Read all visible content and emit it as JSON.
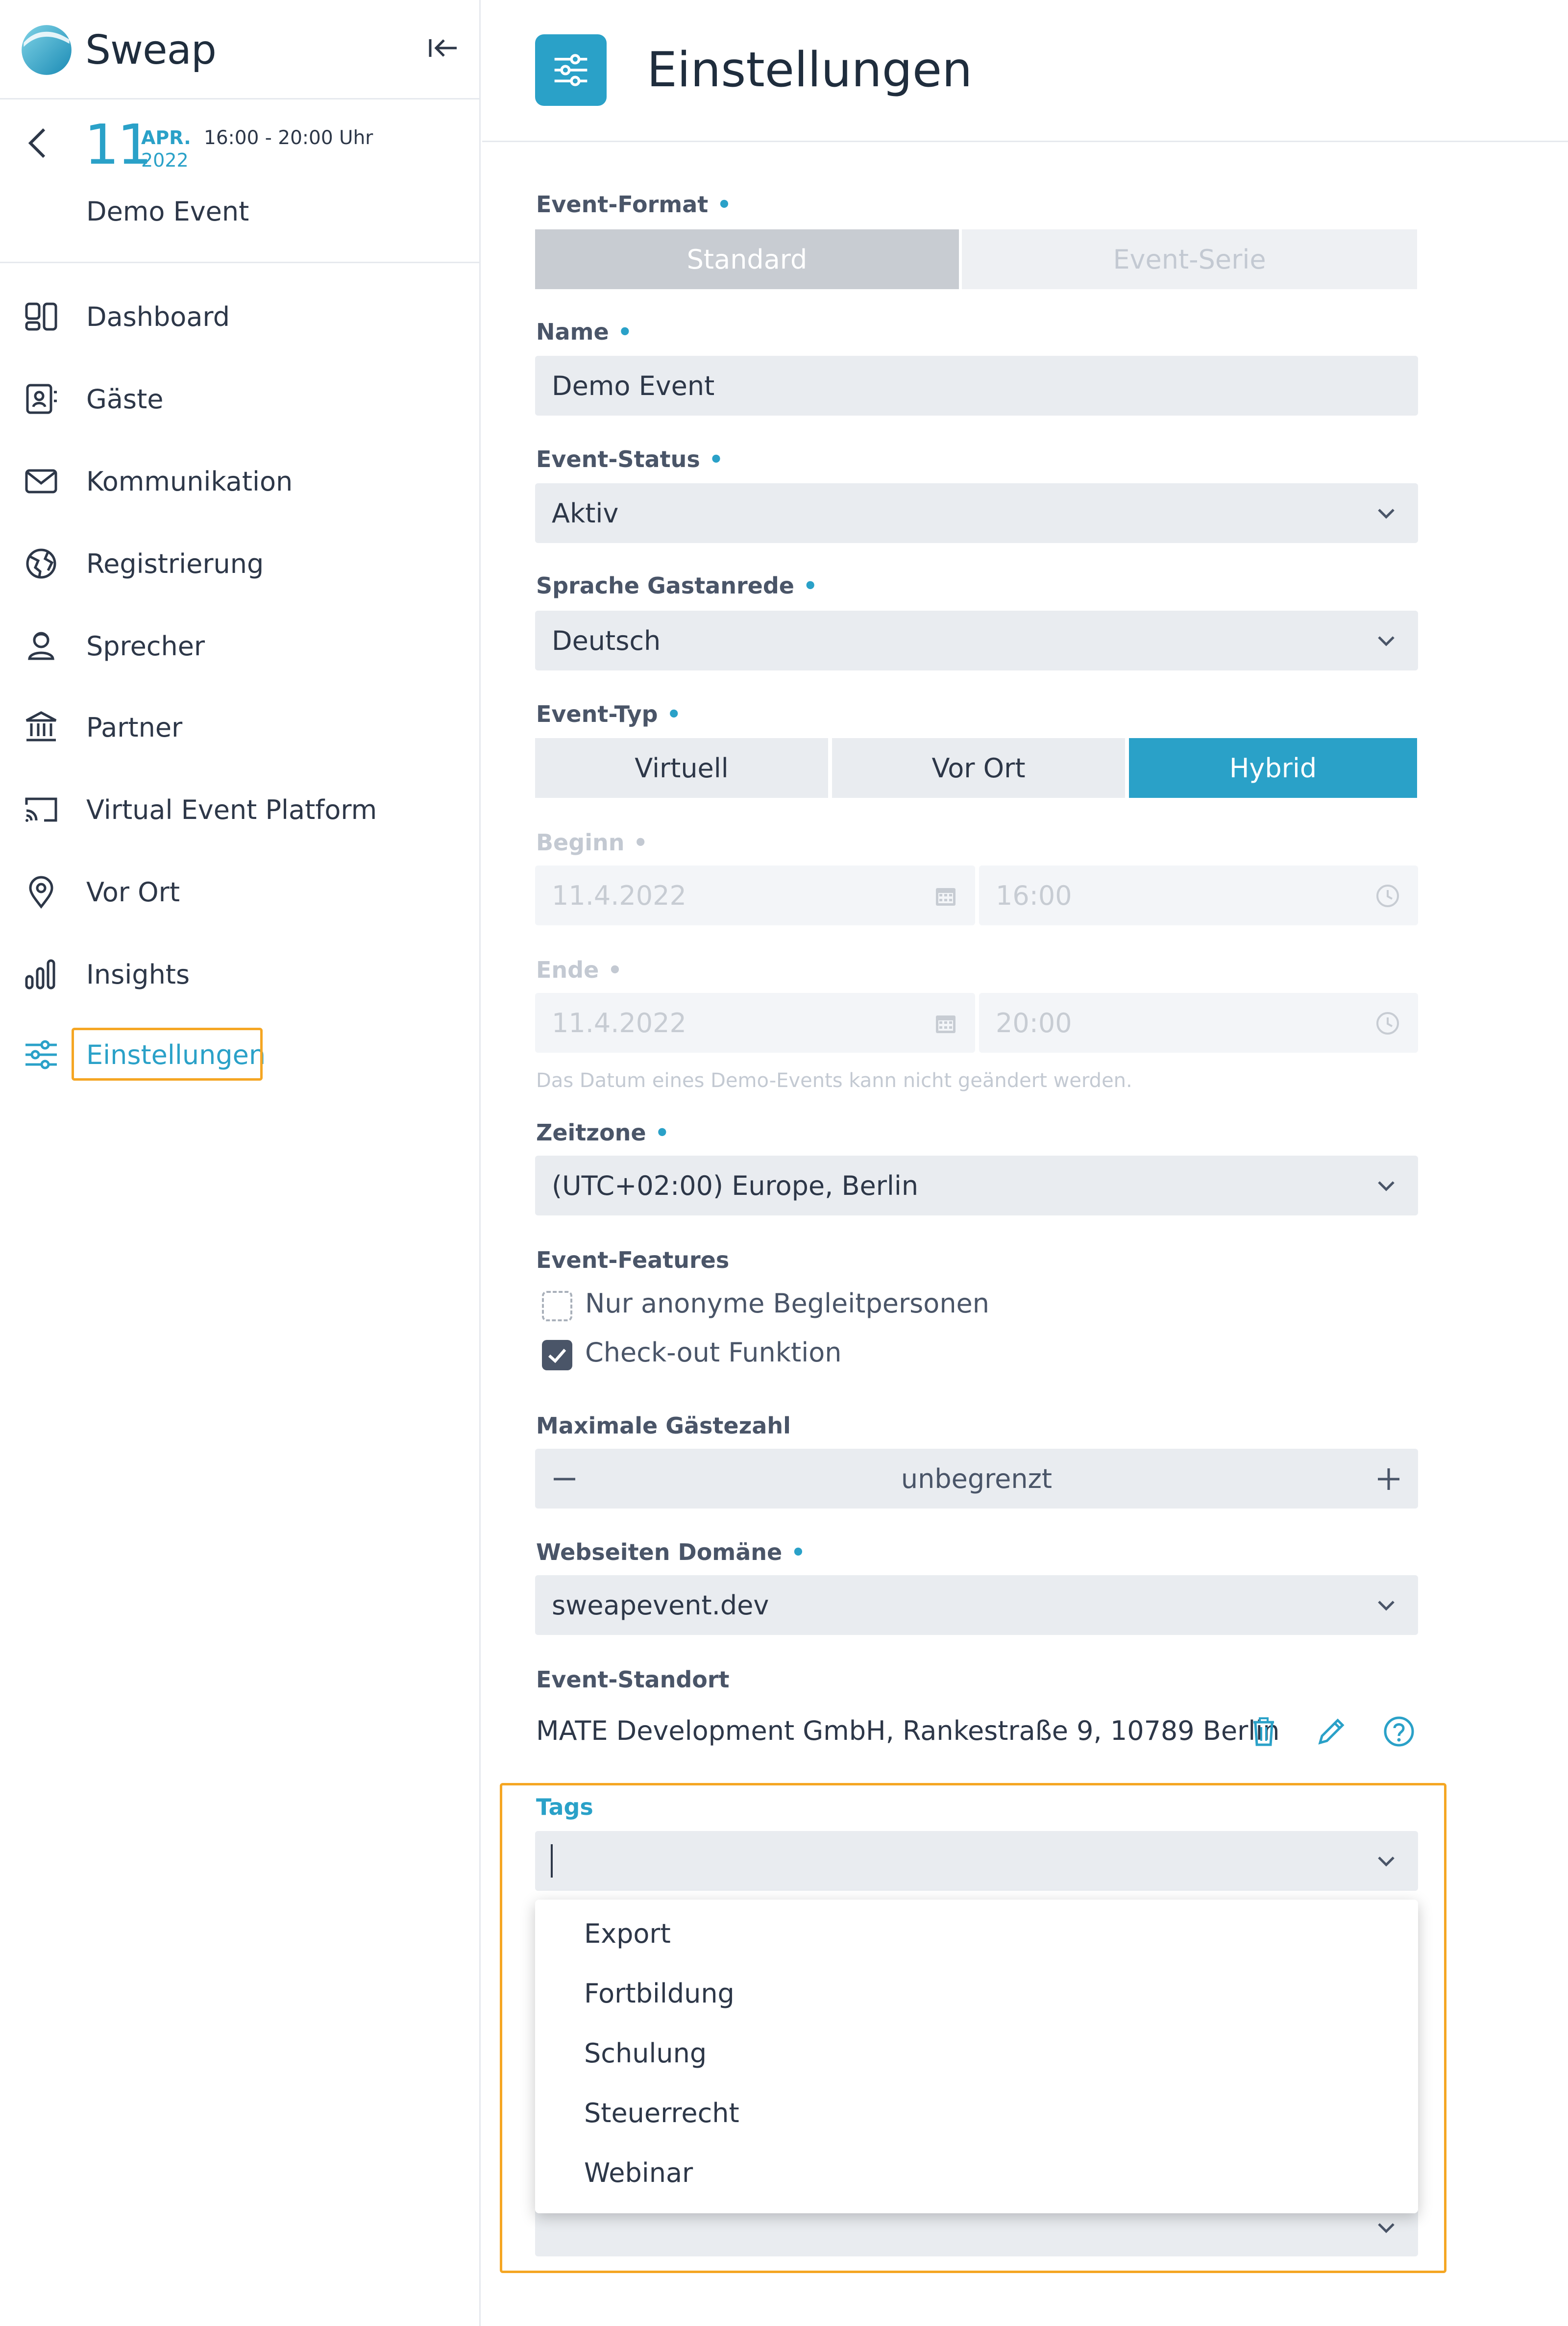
{
  "app": {
    "name": "Sweap"
  },
  "event": {
    "day": "11",
    "month": "APR.",
    "year": "2022",
    "time": "16:00 - 20:00 Uhr",
    "name": "Demo Event"
  },
  "nav": [
    {
      "label": "Dashboard",
      "icon": "dashboard-icon"
    },
    {
      "label": "Gäste",
      "icon": "contacts-icon"
    },
    {
      "label": "Kommunikation",
      "icon": "mail-icon"
    },
    {
      "label": "Registrierung",
      "icon": "globe-icon"
    },
    {
      "label": "Sprecher",
      "icon": "speaker-icon"
    },
    {
      "label": "Partner",
      "icon": "bank-icon"
    },
    {
      "label": "Virtual Event Platform",
      "icon": "cast-icon"
    },
    {
      "label": "Vor Ort",
      "icon": "location-pin-icon"
    },
    {
      "label": "Insights",
      "icon": "bar-chart-icon"
    },
    {
      "label": "Einstellungen",
      "icon": "sliders-icon",
      "active": true
    }
  ],
  "page": {
    "title": "Einstellungen"
  },
  "form": {
    "event_format": {
      "label": "Event-Format",
      "required": "•",
      "options": [
        "Standard",
        "Event-Serie"
      ],
      "selected": "Standard"
    },
    "name": {
      "label": "Name",
      "required": "•",
      "value": "Demo Event"
    },
    "event_status": {
      "label": "Event-Status",
      "required": "•",
      "value": "Aktiv"
    },
    "language": {
      "label": "Sprache Gastanrede",
      "required": "•",
      "value": "Deutsch"
    },
    "event_type": {
      "label": "Event-Typ",
      "required": "•",
      "options": [
        "Virtuell",
        "Vor Ort",
        "Hybrid"
      ],
      "selected": "Hybrid"
    },
    "begin": {
      "label": "Beginn",
      "required": "•",
      "date": "11.4.2022",
      "time": "16:00"
    },
    "end": {
      "label": "Ende",
      "required": "•",
      "date": "11.4.2022",
      "time": "20:00"
    },
    "date_hint": "Das Datum eines Demo-Events kann nicht geändert werden.",
    "timezone": {
      "label": "Zeitzone",
      "required": "•",
      "value": "(UTC+02:00) Europe, Berlin"
    },
    "features": {
      "label": "Event-Features",
      "items": [
        {
          "label": "Nur anonyme Begleitpersonen",
          "checked": false
        },
        {
          "label": "Check-out Funktion",
          "checked": true
        }
      ]
    },
    "max_guests": {
      "label": "Maximale Gästezahl",
      "value": "unbegrenzt"
    },
    "domain": {
      "label": "Webseiten Domäne",
      "required": "•",
      "value": "sweapevent.dev"
    },
    "location": {
      "label": "Event-Standort",
      "value": "MATE Development GmbH, Rankestraße 9, 10789 Berlin"
    },
    "tags": {
      "label": "Tags",
      "value": "",
      "options": [
        "Export",
        "Fortbildung",
        "Schulung",
        "Steuerrecht",
        "Webinar"
      ]
    }
  },
  "colors": {
    "accent": "#2aa1c8",
    "highlight": "#f5a623",
    "field_bg": "#e9ecf0",
    "segment_selected_gray": "#c8ccd2"
  }
}
